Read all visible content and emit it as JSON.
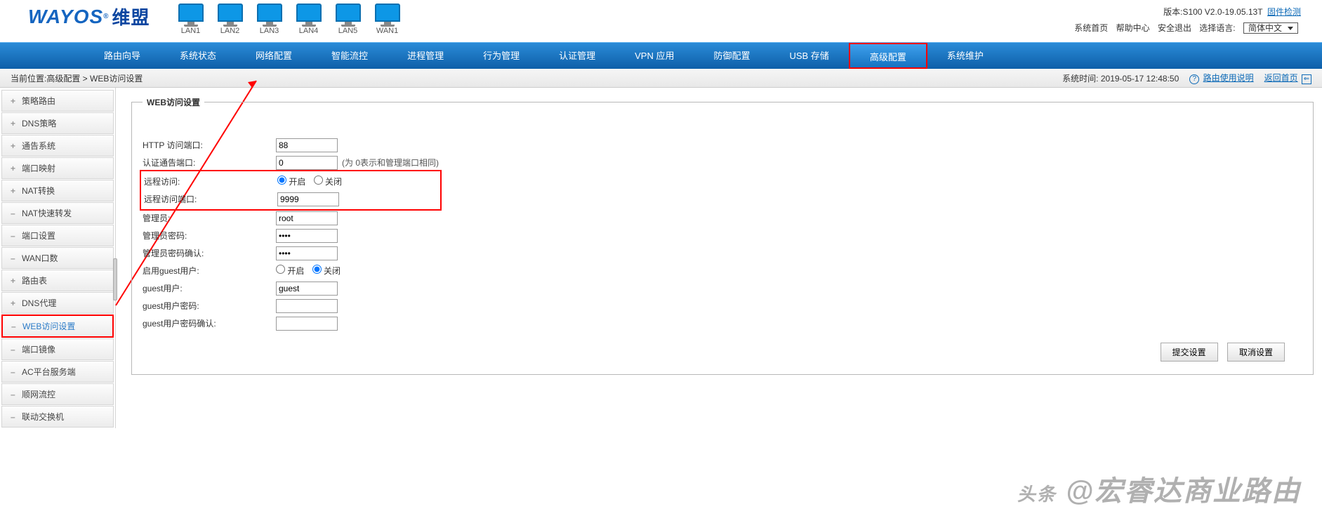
{
  "header": {
    "brand_en": "WAYOS",
    "brand_reg": "®",
    "brand_cn": "维盟",
    "interfaces": [
      {
        "label": "LAN1",
        "on": true
      },
      {
        "label": "LAN2",
        "on": true
      },
      {
        "label": "LAN3",
        "on": true
      },
      {
        "label": "LAN4",
        "on": true
      },
      {
        "label": "LAN5",
        "on": true
      },
      {
        "label": "WAN1",
        "on": true
      }
    ],
    "version_label": "版本:S100 V2.0-19.05.13T",
    "firmware_check": "固件检测",
    "links": {
      "home": "系统首页",
      "help": "帮助中心",
      "logout": "安全退出",
      "lang_label": "选择语言:"
    },
    "lang_value": "简体中文"
  },
  "nav": {
    "items": [
      "路由向导",
      "系统状态",
      "网络配置",
      "智能流控",
      "进程管理",
      "行为管理",
      "认证管理",
      "VPN 应用",
      "防御配置",
      "USB 存储",
      "高级配置",
      "系统维护"
    ],
    "active_index": 10
  },
  "crumb": {
    "path": "当前位置:高级配置 > WEB访问设置",
    "systime_label": "系统时间:",
    "systime_value": "2019-05-17 12:48:50",
    "help_link": "路由使用说明",
    "back_link": "返回首页"
  },
  "sidebar": {
    "items": [
      {
        "exp": "+",
        "label": "策略路由"
      },
      {
        "exp": "+",
        "label": "DNS策略"
      },
      {
        "exp": "+",
        "label": "通告系统"
      },
      {
        "exp": "+",
        "label": "端口映射"
      },
      {
        "exp": "+",
        "label": "NAT转换"
      },
      {
        "exp": "–",
        "label": "NAT快速转发"
      },
      {
        "exp": "–",
        "label": "端口设置"
      },
      {
        "exp": "–",
        "label": "WAN口数"
      },
      {
        "exp": "+",
        "label": "路由表"
      },
      {
        "exp": "+",
        "label": "DNS代理"
      },
      {
        "exp": "–",
        "label": "WEB访问设置",
        "active": true
      },
      {
        "exp": "–",
        "label": "端口镜像"
      },
      {
        "exp": "–",
        "label": "AC平台服务端"
      },
      {
        "exp": "–",
        "label": "顺网流控"
      },
      {
        "exp": "–",
        "label": "联动交换机"
      }
    ]
  },
  "form": {
    "legend": "WEB访问设置",
    "http_port": {
      "label": "HTTP 访问端口:",
      "value": "88"
    },
    "auth_port": {
      "label": "认证通告端口:",
      "value": "0",
      "hint": "(为 0表示和管理端口相同)"
    },
    "remote_access": {
      "label": "远程访问:",
      "on_label": "开启",
      "off_label": "关闭",
      "value": "on"
    },
    "remote_port": {
      "label": "远程访问端口:",
      "value": "9999"
    },
    "admin": {
      "label": "管理员:",
      "value": "root"
    },
    "admin_pwd": {
      "label": "管理员密码:",
      "value": "••••"
    },
    "admin_pwd2": {
      "label": "管理员密码确认:",
      "value": "••••"
    },
    "guest_enable": {
      "label": "启用guest用户:",
      "on_label": "开启",
      "off_label": "关闭",
      "value": "off"
    },
    "guest_user": {
      "label": "guest用户:",
      "value": "guest"
    },
    "guest_pwd": {
      "label": "guest用户密码:",
      "value": ""
    },
    "guest_pwd2": {
      "label": "guest用户密码确认:",
      "value": ""
    },
    "submit": "提交设置",
    "cancel": "取消设置"
  },
  "watermark": {
    "prefix": "头条",
    "at": "@",
    "text": "宏睿达商业路由"
  }
}
